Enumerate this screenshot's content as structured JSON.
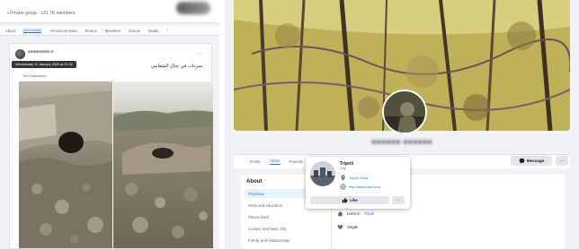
{
  "group": {
    "meta": "▪ Private group · 131.7K members",
    "tabs": [
      "About",
      "Discussion",
      "Announcements",
      "Rooms",
      "Members",
      "Events",
      "Media"
    ],
    "active_tab": "Discussion",
    "more": "›"
  },
  "post": {
    "author": "●●●●●●●● ●",
    "timestamp_tooltip": "Wednesday 11 January 2023 at 21:32",
    "text": "سرداب في جبال الشعانبي",
    "see_translation": "See translation",
    "menu": "···"
  },
  "profile": {
    "name": "●●●●●● ●●●●●●",
    "tabs": [
      "Posts",
      "About",
      "Friends"
    ],
    "active_tab": "About",
    "message_label": "Message",
    "more_label": "···"
  },
  "about": {
    "title": "About",
    "items": [
      "Overview",
      "Work and education",
      "Places lived",
      "Contact and basic info",
      "Family and relationships"
    ],
    "active_item": "Overview"
  },
  "details": [
    {
      "icon": "home-icon",
      "prefix": "Lives in",
      "link": "Tripoli"
    },
    {
      "icon": "heart-icon",
      "prefix": "Single",
      "link": ""
    }
  ],
  "hovercard": {
    "title": "Tripoli",
    "subtitle": "City",
    "row1": "Tripoli, Libya",
    "row2": "http://www.tripoli.info",
    "like_label": "Like",
    "more_label": "···"
  },
  "colors": {
    "facebook_blue": "#1877f2",
    "page_bg": "#f0f2f5",
    "button_bg": "#e4e6eb"
  }
}
